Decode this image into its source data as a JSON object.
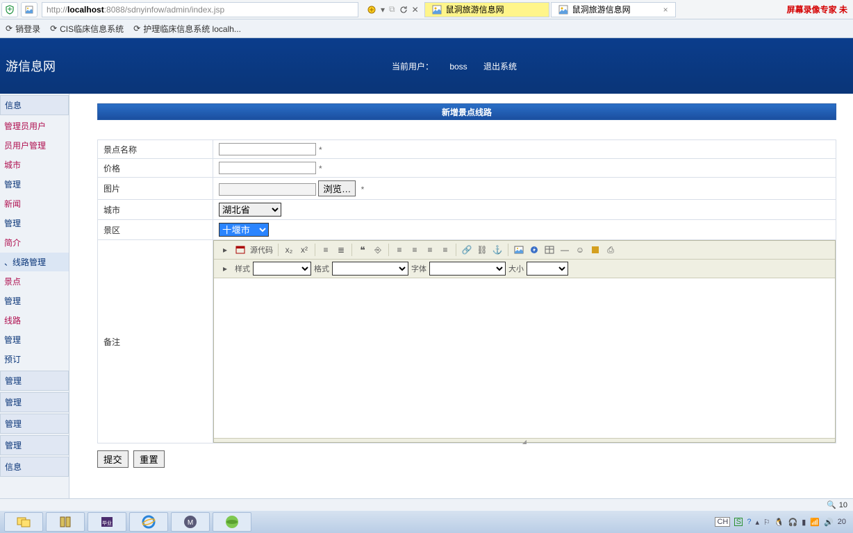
{
  "browser": {
    "url_prefix": "http://",
    "url_host": "localhost",
    "url_rest": ":8088/sdnyinfow/admin/index.jsp",
    "tabs": [
      {
        "title": "鼠洞旅游信息网",
        "active": true
      },
      {
        "title": "鼠洞旅游信息网",
        "active": false
      }
    ],
    "right_badge": "屏幕录像专家 未",
    "favorites": [
      "销登录",
      "CIS临床信息系统",
      "护理临床信息系统 localh..."
    ]
  },
  "header": {
    "site_title": "游信息网",
    "current_user_label": "当前用户：",
    "current_user": "boss",
    "logout": "退出系统"
  },
  "sidebar": {
    "items": [
      {
        "label": "信息",
        "cls": "btnish"
      },
      {
        "label": "管理员用户",
        "cls": ""
      },
      {
        "label": "员用户管理",
        "cls": ""
      },
      {
        "label": "城市",
        "cls": ""
      },
      {
        "label": "管理",
        "cls": "blue"
      },
      {
        "label": "新闻",
        "cls": ""
      },
      {
        "label": "管理",
        "cls": "blue"
      },
      {
        "label": "简介",
        "cls": ""
      },
      {
        "label": "、线路管理",
        "cls": "active"
      },
      {
        "label": "景点",
        "cls": ""
      },
      {
        "label": "管理",
        "cls": "blue"
      },
      {
        "label": "线路",
        "cls": ""
      },
      {
        "label": "管理",
        "cls": "blue"
      },
      {
        "label": "预订",
        "cls": "blue"
      },
      {
        "label": "管理",
        "cls": "btnish"
      },
      {
        "label": "管理",
        "cls": "btnish"
      },
      {
        "label": "管理",
        "cls": "btnish"
      },
      {
        "label": "管理",
        "cls": "btnish"
      },
      {
        "label": "信息",
        "cls": "btnish"
      }
    ]
  },
  "panel_title": "新增景点线路",
  "form": {
    "name_label": "景点名称",
    "price_label": "价格",
    "image_label": "图片",
    "browse_btn": "浏览…",
    "city_label": "城市",
    "city_value": "湖北省",
    "scenic_label": "景区",
    "scenic_value": "十堰市",
    "remark_label": "备注",
    "required": "*"
  },
  "editor": {
    "source_label": "源代码",
    "style_label": "样式",
    "format_label": "格式",
    "font_label": "字体",
    "size_label": "大小"
  },
  "actions": {
    "submit": "提交",
    "reset": "重置"
  },
  "statusbar": {
    "zoom": "10"
  },
  "taskbar": {
    "ime": "CH",
    "time": "20"
  }
}
